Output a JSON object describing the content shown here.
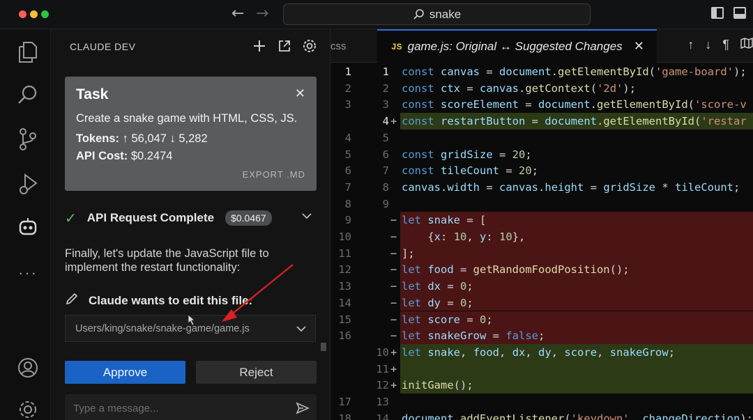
{
  "window": {
    "search_text": "snake"
  },
  "sidebar": {
    "title": "CLAUDE DEV",
    "task": {
      "heading": "Task",
      "description": "Create a snake game with HTML, CSS, JS.",
      "tokens_label": "Tokens:",
      "tokens_value": "↑ 56,047 ↓ 5,282",
      "cost_label": "API Cost:",
      "cost_value": "$0.2474",
      "export_label": "EXPORT .MD"
    },
    "api_request": {
      "label": "API Request Complete",
      "cost": "$0.0467"
    },
    "message": "Finally, let's update the JavaScript file to implement the restart functionality:",
    "edit_label": "Claude wants to edit this file:",
    "file_path": "Users/king/snake/snake-game/game.js",
    "approve_label": "Approve",
    "reject_label": "Reject",
    "input_placeholder": "Type a message..."
  },
  "tabs": {
    "partial_tab": "css",
    "active_badge": "JS",
    "active_title": "game.js: Original ↔ Suggested Changes"
  },
  "editor": {
    "lines": [
      {
        "old": "1",
        "new": "1",
        "type": "cur",
        "marker": "",
        "code": "const canvas = document.getElementById('game-board');"
      },
      {
        "old": "2",
        "new": "2",
        "type": "",
        "marker": "",
        "code": "const ctx = canvas.getContext('2d');"
      },
      {
        "old": "3",
        "new": "3",
        "type": "",
        "marker": "",
        "code": "const scoreElement = document.getElementById('score-v"
      },
      {
        "old": "",
        "new": "4",
        "type": "add cur",
        "marker": "+",
        "code": "const restartButton = document.getElementById('restar"
      },
      {
        "old": "4",
        "new": "5",
        "type": "",
        "marker": "",
        "code": ""
      },
      {
        "old": "5",
        "new": "6",
        "type": "",
        "marker": "",
        "code": "const gridSize = 20;"
      },
      {
        "old": "6",
        "new": "7",
        "type": "",
        "marker": "",
        "code": "const tileCount = 20;"
      },
      {
        "old": "7",
        "new": "8",
        "type": "",
        "marker": "",
        "code": "canvas.width = canvas.height = gridSize * tileCount;"
      },
      {
        "old": "8",
        "new": "9",
        "type": "",
        "marker": "",
        "code": ""
      },
      {
        "old": "9",
        "new": "",
        "type": "rem",
        "marker": "−",
        "code": "let snake = ["
      },
      {
        "old": "10",
        "new": "",
        "type": "rem",
        "marker": "−",
        "code": "    {x: 10, y: 10},"
      },
      {
        "old": "11",
        "new": "",
        "type": "rem",
        "marker": "−",
        "code": "];"
      },
      {
        "old": "12",
        "new": "",
        "type": "rem",
        "marker": "−",
        "code": "let food = getRandomFoodPosition();"
      },
      {
        "old": "13",
        "new": "",
        "type": "rem",
        "marker": "−",
        "code": "let dx = 0;"
      },
      {
        "old": "14",
        "new": "",
        "type": "rem",
        "marker": "−",
        "code": "let dy = 0;"
      },
      {
        "old": "15",
        "new": "",
        "type": "rem",
        "marker": "−",
        "code": "let score = 0;"
      },
      {
        "old": "16",
        "new": "",
        "type": "rem",
        "marker": "−",
        "code": "let snakeGrow = false;"
      },
      {
        "old": "",
        "new": "10",
        "type": "add",
        "marker": "+",
        "code": "let snake, food, dx, dy, score, snakeGrow;"
      },
      {
        "old": "",
        "new": "11",
        "type": "add",
        "marker": "+",
        "code": ""
      },
      {
        "old": "",
        "new": "12",
        "type": "add",
        "marker": "+",
        "code": "initGame();"
      },
      {
        "old": "17",
        "new": "13",
        "type": "",
        "marker": "",
        "code": ""
      },
      {
        "old": "18",
        "new": "14",
        "type": "",
        "marker": "",
        "code": "document.addEventListener('keydown', changeDirection);"
      }
    ]
  }
}
